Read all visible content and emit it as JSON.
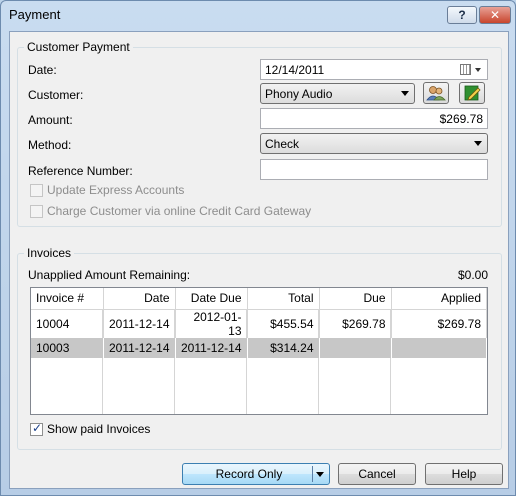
{
  "window": {
    "title": "Payment",
    "help_glyph": "?",
    "close_glyph": "✕"
  },
  "customer_payment": {
    "legend": "Customer Payment",
    "date_label": "Date:",
    "date_value": "12/14/2011",
    "customer_label": "Customer:",
    "customer_value": "Phony Audio",
    "amount_label": "Amount:",
    "amount_value": "$269.78",
    "method_label": "Method:",
    "method_value": "Check",
    "reference_label": "Reference Number:",
    "reference_value": "",
    "update_express_label": "Update Express Accounts",
    "charge_customer_label": "Charge Customer via online Credit Card Gateway"
  },
  "invoices": {
    "legend": "Invoices",
    "unapplied_label": "Unapplied Amount Remaining:",
    "unapplied_value": "$0.00",
    "columns": [
      "Invoice #",
      "Date",
      "Date Due",
      "Total",
      "Due",
      "Applied"
    ],
    "rows": [
      [
        "10004",
        "2011-12-14",
        "2012-01-13",
        "$455.54",
        "$269.78",
        "$269.78"
      ],
      [
        "10003",
        "2011-12-14",
        "2011-12-14",
        "$314.24",
        "",
        ""
      ]
    ],
    "selected_row": 1,
    "show_paid_label": "Show paid Invoices",
    "show_paid_checked": true
  },
  "buttons": {
    "record": "Record Only",
    "cancel": "Cancel",
    "help": "Help"
  },
  "colors": {
    "selection": "#c7c7c7",
    "title_bg": "#c9dcf0",
    "close": "#c8452d"
  }
}
